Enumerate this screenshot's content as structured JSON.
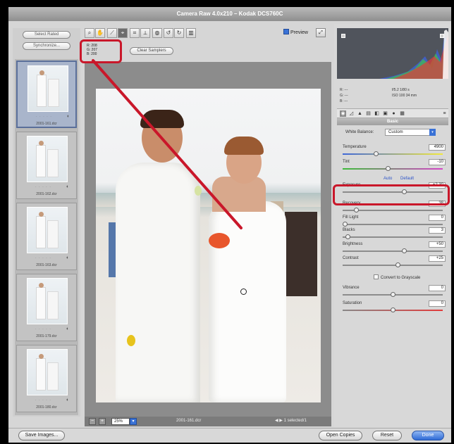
{
  "window": {
    "title": "Camera Raw 4.0x210  –  Kodak DCS760C"
  },
  "filmstrip": {
    "select_all_label": "Select Rated",
    "synchronize_label": "Synchronize...",
    "thumbnails": [
      {
        "stars": "· · · · ·",
        "filename": "2001-161.dcr",
        "selected": true
      },
      {
        "stars": "· · · · ·",
        "filename": "2001-162.dcr",
        "selected": false
      },
      {
        "stars": "· · · · ·",
        "filename": "2001-163.dcr",
        "selected": false
      },
      {
        "stars": "· · · · ·",
        "filename": "2001-179.dcr",
        "selected": false
      },
      {
        "stars": "· · · · ·",
        "filename": "2001-180.dcr",
        "selected": false
      }
    ]
  },
  "toolbar": {
    "tools": [
      "zoom-icon",
      "hand-icon",
      "white-balance-icon",
      "color-sampler-icon",
      "crop-icon",
      "straighten-icon",
      "retouch-icon",
      "rotate-left-icon",
      "rotate-right-icon",
      "trash-icon"
    ],
    "preview_label": "Preview",
    "clear_samplers_label": "Clear Samplers"
  },
  "sampler": {
    "line1": "R: 208",
    "line2": "G: 207",
    "line3": "B: 200"
  },
  "canvas_footer": {
    "zoom_value": "25%",
    "filename": "2001-161.dcr",
    "nav_text": "◀ ▶  1 selected/1"
  },
  "histogram": {
    "colors": [
      "#3e60d8",
      "#e23a3a",
      "#41c24a",
      "#ffffff"
    ]
  },
  "rgb_readout": {
    "r": "R: ---",
    "g": "G: ---",
    "b": "B: ---",
    "exposure_info": "f/5.2   1/80 s",
    "iso_info": "ISO 100   34 mm"
  },
  "basic_panel": {
    "title": "Basic",
    "white_balance_label": "White Balance:",
    "white_balance_value": "Custom",
    "auto_label": "Auto",
    "default_label": "Default",
    "convert_grayscale_label": "Convert to Grayscale",
    "sliders": [
      {
        "label": "Temperature",
        "value": "4900",
        "fraction": 0.32,
        "track": "temp"
      },
      {
        "label": "Tint",
        "value": "-10",
        "fraction": 0.45,
        "track": "tint"
      },
      {
        "label": "Exposure",
        "value": "+2.30",
        "fraction": 0.62,
        "track": "plain"
      },
      {
        "label": "Recovery",
        "value": "38",
        "fraction": 0.12,
        "track": "plain"
      },
      {
        "label": "Fill Light",
        "value": "0",
        "fraction": 0.0,
        "track": "plain"
      },
      {
        "label": "Blacks",
        "value": "3",
        "fraction": 0.03,
        "track": "plain"
      },
      {
        "label": "Brightness",
        "value": "+50",
        "fraction": 0.62,
        "track": "plain"
      },
      {
        "label": "Contrast",
        "value": "+25",
        "fraction": 0.55,
        "track": "plain"
      },
      {
        "label": "Vibrance",
        "value": "0",
        "fraction": 0.5,
        "track": "plain"
      },
      {
        "label": "Saturation",
        "value": "0",
        "fraction": 0.5,
        "track": "sat"
      }
    ]
  },
  "bottom_bar": {
    "save_images_label": "Save Images...",
    "open_copies_label": "Open Copies",
    "reset_label": "Reset",
    "done_label": "Done"
  },
  "colors": {
    "annotation": "#c9172a",
    "accent": "#2f6bd6"
  }
}
